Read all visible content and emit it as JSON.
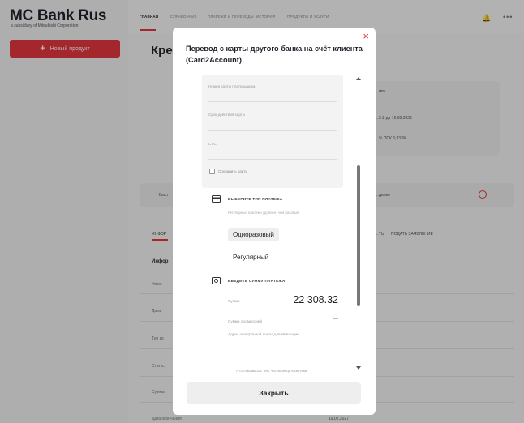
{
  "bank": {
    "name": "MC Bank Rus",
    "subtitle": "a subsidiary of Mitsubishi Corporation"
  },
  "sidebar": {
    "new_product": "Новый продукт"
  },
  "nav": {
    "items": [
      "ГЛАВНАЯ",
      "СПРАВОЧНИК",
      "ПЛАТЕЖИ И ПЕРЕВОДЫ",
      "ИСТОРИЯ",
      "ПРОДУКТЫ И УСЛУГИ"
    ]
  },
  "background": {
    "page_title": "Кре",
    "card_lines": [
      "…ита",
      "…2 ₽ до 16.09.2025",
      "…% ПСК 6,933%"
    ],
    "bar_left": "Быст",
    "bar_right": "…дание",
    "tabs": [
      "ИНФОР",
      "…ТЬ",
      "ПОДАТЬ ЗАЯВЛЕНИЕ"
    ],
    "info_title": "Инфор",
    "rows": [
      "Номе",
      "Дата",
      "Тип кр",
      "Статус",
      "Сумма",
      "Дата окончания"
    ],
    "last_value": "19.02.2027"
  },
  "modal": {
    "title": "Перевод с карты другого банка на счёт клиента (Card2Account)",
    "close_icon": "×",
    "fields": {
      "card_number": "Номер карты плательщика",
      "expiry": "Срок действия карты",
      "cvc": "CVC",
      "save_card": "Сохранить карту"
    },
    "payment_type": {
      "title": "ВЫБЕРИТЕ ТИП ПЛАТЕЖА",
      "hint": "Регулярные платежи удобнее, чем разовые",
      "options": [
        "Одноразовый",
        "Регулярный"
      ],
      "selected": "Одноразовый"
    },
    "amount": {
      "title": "ВВЕДИТЕ СУММУ ПЛАТЕЖА",
      "sum_label": "Сумма",
      "sum_value": "22 308.32",
      "commission_label": "Сумма с комиссией",
      "commission_value": "—",
      "email_placeholder": "Адрес электронной почты для квитанции",
      "agree_text": "Я соглашаюсь с тем, что перевод в системе"
    },
    "close_button": "Закрыть"
  },
  "colors": {
    "accent": "#e2363e",
    "overlay": "rgba(0,0,0,0.28)"
  },
  "icons": {
    "bell": "bell-icon",
    "more": "more-dots-icon",
    "close": "close-icon",
    "card": "card-icon",
    "amount": "money-icon"
  }
}
